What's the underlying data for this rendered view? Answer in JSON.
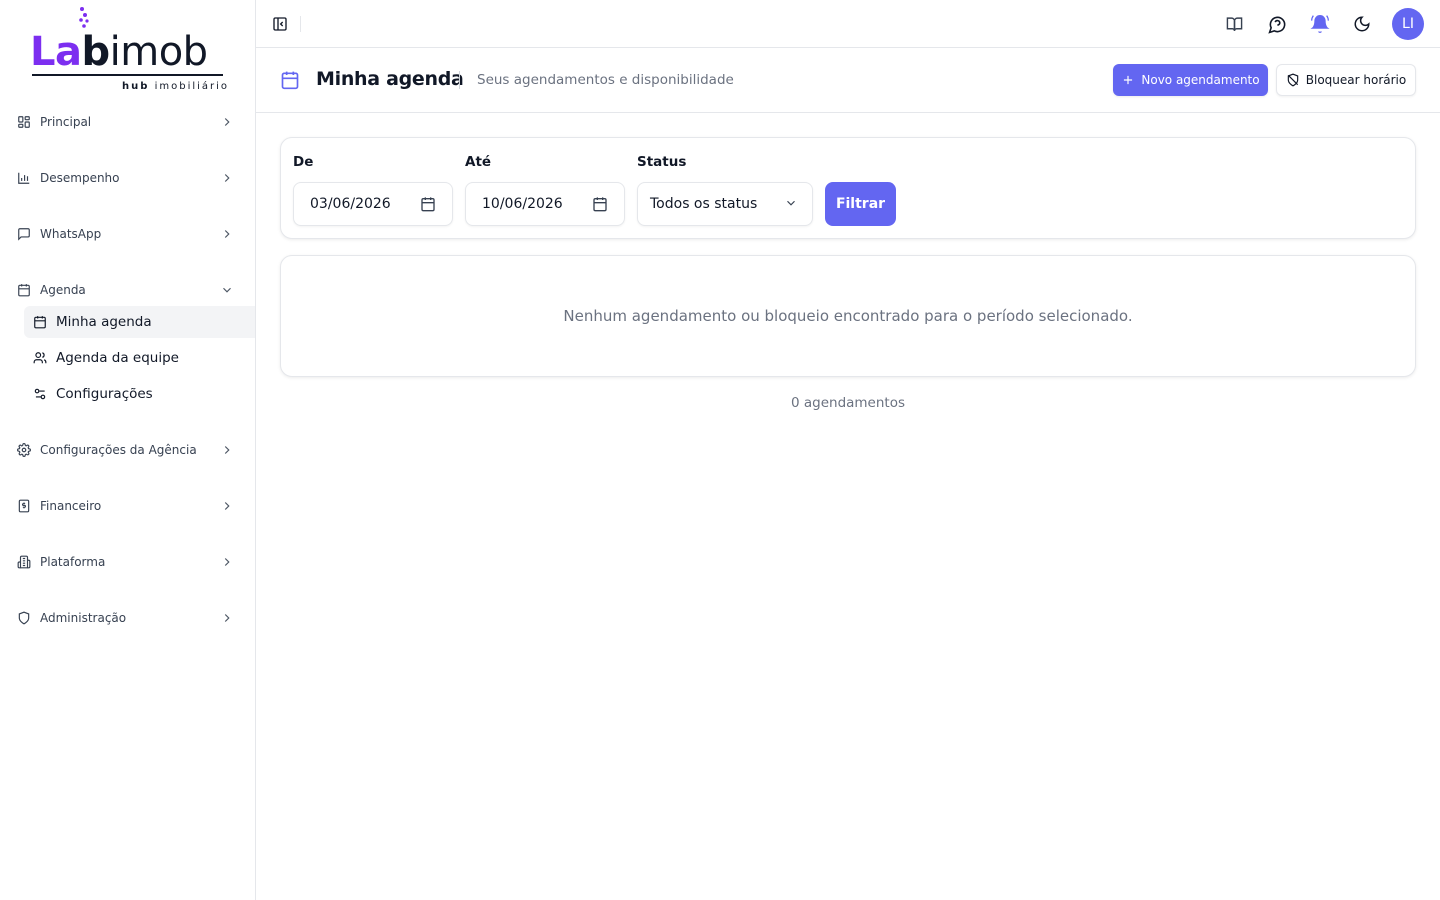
{
  "brand": {
    "logo_part1": "La",
    "logo_part2": "b",
    "logo_part3": "imob",
    "logo_sub_bold": "hub",
    "logo_sub_rest": " imobiliário",
    "accent_color": "#7c2ef0"
  },
  "sidebar": {
    "items": [
      {
        "label": "Principal",
        "icon": "grid-icon"
      },
      {
        "label": "Desempenho",
        "icon": "bar-chart-icon"
      },
      {
        "label": "WhatsApp",
        "icon": "message-square-icon"
      },
      {
        "label": "Agenda",
        "icon": "calendar-icon",
        "expanded": true
      },
      {
        "label": "Configurações da Agência",
        "icon": "gear-icon"
      },
      {
        "label": "Financeiro",
        "icon": "receipt-dollar-icon"
      },
      {
        "label": "Plataforma",
        "icon": "building-icon"
      },
      {
        "label": "Administração",
        "icon": "shield-icon"
      }
    ],
    "agenda_sub": [
      {
        "label": "Minha agenda",
        "icon": "calendar-days-icon",
        "active": true
      },
      {
        "label": "Agenda da equipe",
        "icon": "users-icon"
      },
      {
        "label": "Configurações",
        "icon": "sliders-icon"
      }
    ]
  },
  "topbar": {
    "avatar_initials": "LI",
    "icons": [
      "book-open-icon",
      "help-message-icon",
      "bell-ringing-icon",
      "moon-icon"
    ],
    "bell_color": "#6366f1"
  },
  "header": {
    "title": "Minha agenda",
    "subtitle": "Seus agendamentos e disponibilidade",
    "new_button": "Novo agendamento",
    "block_button": "Bloquear horário"
  },
  "filters": {
    "from_label": "De",
    "from_value": "03/06/2026",
    "to_label": "Até",
    "to_value": "10/06/2026",
    "status_label": "Status",
    "status_value": "Todos os status",
    "filter_button": "Filtrar"
  },
  "results": {
    "empty_message": "Nenhum agendamento ou bloqueio encontrado para o período selecionado.",
    "count_text": "0 agendamentos"
  },
  "colors": {
    "primary": "#6366f1",
    "border": "#e5e7eb",
    "muted_text": "#6b7280"
  }
}
